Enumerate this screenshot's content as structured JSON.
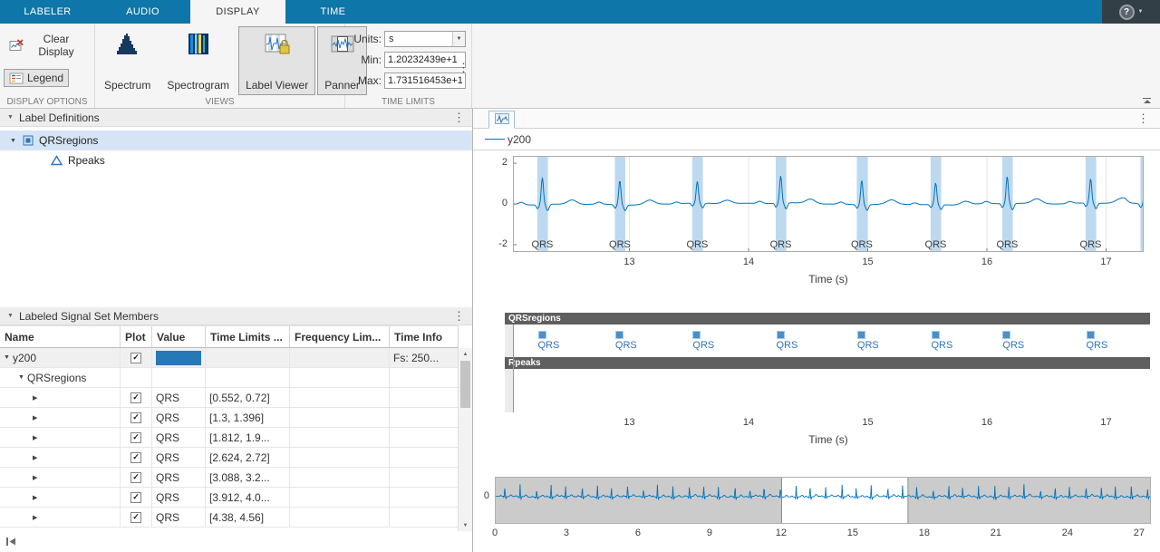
{
  "colors": {
    "topbar": "#0e76a8",
    "line": "#0072BD",
    "band": "#bdd9ef",
    "marker_fill": "#4a8fc7",
    "lane_bar": "#5f5f5f",
    "value_fill": "#2878b5",
    "selection": "#d6e5f5"
  },
  "top_tabs": {
    "items": [
      "LABELER",
      "AUDIO",
      "DISPLAY",
      "TIME"
    ],
    "active": "DISPLAY",
    "help_label": "?"
  },
  "ribbon": {
    "display_options": {
      "section_label": "DISPLAY OPTIONS",
      "clear_display_label": "Clear Display",
      "legend_label": "Legend"
    },
    "views": {
      "section_label": "VIEWS",
      "buttons": [
        {
          "label": "Spectrum",
          "selected": false
        },
        {
          "label": "Spectrogram",
          "selected": false
        },
        {
          "label": "Label Viewer",
          "selected": true
        },
        {
          "label": "Panner",
          "selected": true
        }
      ]
    },
    "time_limits": {
      "section_label": "TIME LIMITS",
      "units_label": "Units:",
      "units_value": "s",
      "min_label": "Min:",
      "min_value": "1.20232439e+1",
      "max_label": "Max:",
      "max_value": "1.731516453e+1"
    }
  },
  "left": {
    "label_definitions": {
      "title": "Label Definitions",
      "items": [
        {
          "name": "QRSregions",
          "icon": "region-label-icon",
          "indent": 0,
          "selected": true,
          "expander": "open"
        },
        {
          "name": "Rpeaks",
          "icon": "point-label-icon",
          "indent": 1,
          "selected": false,
          "expander": "none"
        }
      ]
    },
    "members": {
      "title": "Labeled Signal Set Members",
      "columns": [
        "Name",
        "Plot",
        "Value",
        "Time Limits ...",
        "Frequency Lim...",
        "Time Info"
      ],
      "rows": [
        {
          "name": "y200",
          "indent": 0,
          "expander": "open",
          "checked": true,
          "value": "",
          "value_fill": true,
          "time_limits": "",
          "time_info": "Fs: 250...",
          "shaded": true
        },
        {
          "name": "QRSregions",
          "indent": 1,
          "expander": "open",
          "checked": null,
          "value": "",
          "value_fill": false,
          "time_limits": "",
          "time_info": "",
          "shaded": false
        },
        {
          "name": "",
          "indent": 2,
          "expander": "closed",
          "checked": true,
          "value": "QRS",
          "value_fill": false,
          "time_limits": "[0.552, 0.72]",
          "time_info": "",
          "shaded": false
        },
        {
          "name": "",
          "indent": 2,
          "expander": "closed",
          "checked": true,
          "value": "QRS",
          "value_fill": false,
          "time_limits": "[1.3, 1.396]",
          "time_info": "",
          "shaded": false
        },
        {
          "name": "",
          "indent": 2,
          "expander": "closed",
          "checked": true,
          "value": "QRS",
          "value_fill": false,
          "time_limits": "[1.812, 1.9...",
          "time_info": "",
          "shaded": false
        },
        {
          "name": "",
          "indent": 2,
          "expander": "closed",
          "checked": true,
          "value": "QRS",
          "value_fill": false,
          "time_limits": "[2.624, 2.72]",
          "time_info": "",
          "shaded": false
        },
        {
          "name": "",
          "indent": 2,
          "expander": "closed",
          "checked": true,
          "value": "QRS",
          "value_fill": false,
          "time_limits": "[3.088, 3.2...",
          "time_info": "",
          "shaded": false
        },
        {
          "name": "",
          "indent": 2,
          "expander": "closed",
          "checked": true,
          "value": "QRS",
          "value_fill": false,
          "time_limits": "[3.912, 4.0...",
          "time_info": "",
          "shaded": false
        },
        {
          "name": "",
          "indent": 2,
          "expander": "closed",
          "checked": true,
          "value": "QRS",
          "value_fill": false,
          "time_limits": "[4.38, 4.56]",
          "time_info": "",
          "shaded": false
        }
      ]
    }
  },
  "viewer": {
    "legend_label": "y200",
    "main_plot": {
      "xlim": [
        12.0232439,
        17.31516453
      ],
      "ylim": [
        -2.36,
        2.36
      ],
      "xticks": [
        13,
        14,
        15,
        16,
        17
      ],
      "yticks": [
        2,
        0,
        -2
      ],
      "xlabel": "Time (s)",
      "region_label": "QRS",
      "qrs_times": [
        12.27,
        12.92,
        13.57,
        14.27,
        14.95,
        15.57,
        16.17,
        16.87
      ],
      "edge_qrs_time": 17.33
    },
    "label_panel": {
      "lanes": [
        {
          "title": "QRSregions",
          "marker_label": "QRS",
          "has_markers": true
        },
        {
          "title": "Rpeaks",
          "marker_label": "",
          "has_markers": false
        }
      ],
      "xticks": [
        13,
        14,
        15,
        16,
        17
      ],
      "xlabel": "Time (s)"
    },
    "panner": {
      "xlim": [
        0,
        27.5
      ],
      "xticks": [
        0,
        3,
        6,
        9,
        12,
        15,
        18,
        21,
        24,
        27
      ],
      "window": [
        12.0232439,
        17.31516453
      ],
      "ytick": "0"
    }
  }
}
